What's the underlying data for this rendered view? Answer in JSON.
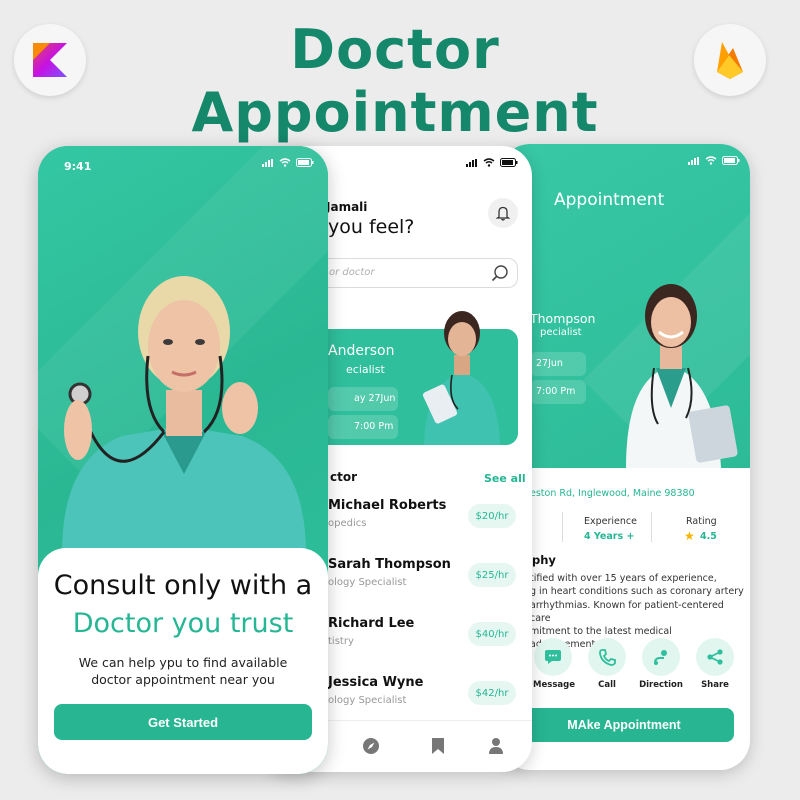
{
  "header": {
    "title": "Doctor  Appointment",
    "left_logo_icon": "kotlin-logo-icon",
    "right_logo_icon": "firebase-logo-icon"
  },
  "colors": {
    "brand": "#25b693",
    "title": "#15876b",
    "chip_bg": "#e6f7f2"
  },
  "onboarding": {
    "status_time": "9:41",
    "heading_line1": "Consult only with a",
    "heading_line2": "Doctor you trust",
    "description": "We can help ypu to find available doctor appointment near you",
    "cta_label": "Get Started"
  },
  "home": {
    "greeting": "Jamali",
    "question": "you feel?",
    "search_placeholder": "or doctor",
    "banner": {
      "name": "Anderson",
      "specialty": "ecialist",
      "date": "ay 27Jun",
      "time": "7:00 Pm"
    },
    "section_title": "ctor",
    "see_all": "See all",
    "doctors": [
      {
        "name": "Michael Roberts",
        "specialty": "opedics",
        "price": "$20/hr"
      },
      {
        "name": "Sarah Thompson",
        "specialty": "ology Specialist",
        "price": "$25/hr"
      },
      {
        "name": "Richard Lee",
        "specialty": "tistry",
        "price": "$40/hr"
      },
      {
        "name": "Jessica Wyne",
        "specialty": "ology Specialist",
        "price": "$42/hr"
      }
    ],
    "nav_icons": [
      "compass-icon",
      "bookmark-icon",
      "profile-icon"
    ]
  },
  "appointment": {
    "title": "Appointment",
    "doctor_name": "Thompson",
    "doctor_specialty": "pecialist",
    "date": "27Jun",
    "time": "7:00 Pm",
    "address": "eston Rd, Inglewood, Maine 98380",
    "stats": [
      {
        "label": "Experience",
        "value": "4 Years +"
      },
      {
        "label": "Rating",
        "value": "4.5"
      }
    ],
    "bio_title": "phy",
    "bio_lines": [
      "tified with over 15 years of experience,",
      "g in heart conditions such as coronary artery",
      " arrhythmias. Known for patient-centered care",
      "mitment to the latest medical advancements"
    ],
    "actions": [
      {
        "label": "Message",
        "icon": "message-icon"
      },
      {
        "label": "Call",
        "icon": "phone-icon"
      },
      {
        "label": "Direction",
        "icon": "direction-icon"
      },
      {
        "label": "Share",
        "icon": "share-icon"
      }
    ],
    "cta_label": "MAke Appointment"
  }
}
